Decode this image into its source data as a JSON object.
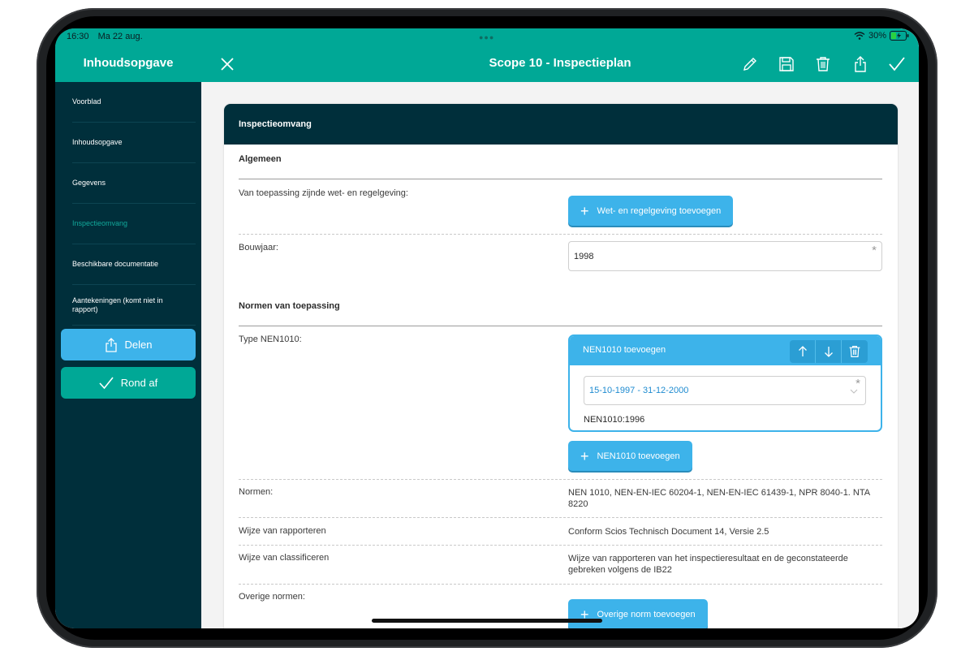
{
  "status": {
    "time": "16:30",
    "date": "Ma 22 aug.",
    "battery": "30%"
  },
  "sidebar": {
    "title": "Inhoudsopgave",
    "items": [
      {
        "label": "Voorblad"
      },
      {
        "label": "Inhoudsopgave"
      },
      {
        "label": "Gegevens"
      },
      {
        "label": "Inspectieomvang"
      },
      {
        "label": "Beschikbare documentatie"
      },
      {
        "label": "Aantekeningen (komt niet in rapport)"
      }
    ],
    "share_label": "Delen",
    "finish_label": "Rond af"
  },
  "topbar": {
    "title": "Scope 10 - Inspectieplan"
  },
  "card": {
    "header": "Inspectieomvang",
    "general": {
      "title": "Algemeen",
      "law_label": "Van toepassing zijnde wet- en regelgeving:",
      "law_button": "Wet- en regelgeving toevoegen",
      "year_label": "Bouwjaar:",
      "year_value": "1998"
    },
    "norms": {
      "title": "Normen van toepassing",
      "type_label": "Type NEN1010:",
      "nen_header": "NEN1010 toevoegen",
      "nen_period": "15-10-1997 - 31-12-2000",
      "nen_standard": "NEN1010:1996",
      "nen_add_button": "NEN1010 toevoegen",
      "norms_label": "Normen:",
      "norms_value": "NEN 1010, NEN-EN-IEC 60204-1, NEN-EN-IEC 61439-1, NPR 8040-1. NTA 8220",
      "reporting_label": "Wijze van rapporteren",
      "reporting_value": "Conform Scios Technisch Document 14, Versie 2.5",
      "classify_label": "Wijze van classificeren",
      "classify_value": "Wijze van rapporteren van het inspectieresultaat en de geconstateerde gebreken volgens de IB22",
      "other_label": "Overige normen:",
      "other_button": "Overige norm toevoegen"
    }
  },
  "colors": {
    "accent": "#00a896",
    "dark": "#002f3b",
    "blue": "#3db3ea"
  }
}
